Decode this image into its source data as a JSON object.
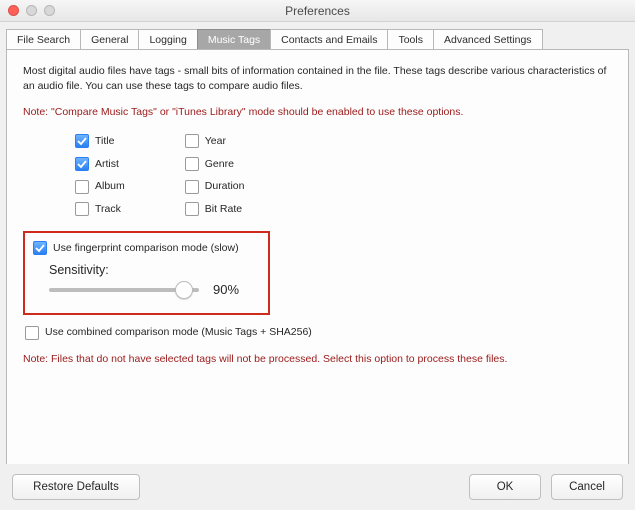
{
  "window": {
    "title": "Preferences"
  },
  "tabs": [
    {
      "label": "File Search"
    },
    {
      "label": "General"
    },
    {
      "label": "Logging"
    },
    {
      "label": "Music Tags",
      "active": true
    },
    {
      "label": "Contacts and Emails"
    },
    {
      "label": "Tools"
    },
    {
      "label": "Advanced Settings"
    }
  ],
  "intro": "Most digital audio files have tags - small bits of information contained in the file. These tags describe various characteristics of an audio file. You can use these tags to compare audio files.",
  "note_top": "Note: \"Compare Music Tags\" or \"iTunes Library\" mode should be enabled to use these options.",
  "checks_left": [
    {
      "label": "Title",
      "checked": true
    },
    {
      "label": "Artist",
      "checked": true
    },
    {
      "label": "Album",
      "checked": false
    },
    {
      "label": "Track",
      "checked": false
    }
  ],
  "checks_right": [
    {
      "label": "Year",
      "checked": false
    },
    {
      "label": "Genre",
      "checked": false
    },
    {
      "label": "Duration",
      "checked": false
    },
    {
      "label": "Bit Rate",
      "checked": false
    }
  ],
  "fingerprint": {
    "label": "Use fingerprint comparison mode (slow)",
    "checked": true,
    "sensitivity_label": "Sensitivity:",
    "value": 90,
    "value_text": "90%"
  },
  "combined": {
    "label": "Use combined comparison mode (Music Tags + SHA256)",
    "checked": false
  },
  "note_bottom": "Note: Files that do not have selected tags will not be processed. Select this option to process these files.",
  "buttons": {
    "restore": "Restore Defaults",
    "ok": "OK",
    "cancel": "Cancel"
  }
}
